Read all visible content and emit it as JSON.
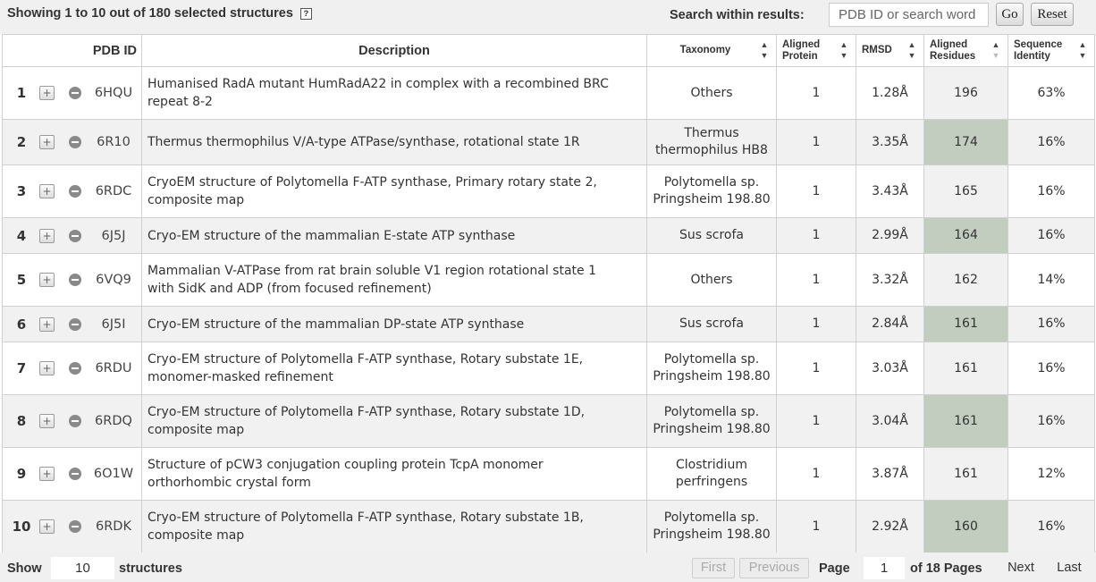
{
  "header": {
    "showing_text": "Showing 1 to 10 out of 180 selected structures",
    "help_icon": "?",
    "search_label": "Search within results:",
    "search_placeholder": "PDB ID or search word",
    "go_label": "Go",
    "reset_label": "Reset"
  },
  "columns": {
    "pdb_id": "PDB ID",
    "description": "Description",
    "taxonomy": "Taxonomy",
    "aligned_protein": [
      "Aligned",
      "Protein"
    ],
    "rmsd": "RMSD",
    "aligned_residues": [
      "Aligned",
      "Residues"
    ],
    "sequence_identity": [
      "Sequence",
      "Identity"
    ],
    "sort_up": "▲",
    "sort_down": "▼",
    "active_sort": "aligned_residues-desc"
  },
  "icons": {
    "expand": "plus-icon",
    "cart": "circle-minus-icon",
    "expand_glyph": "+"
  },
  "colors": {
    "highlight_cell": "#c2cdbf",
    "row_alt": "#f1f1f1",
    "bar_bg": "#f0f0f0"
  },
  "rows": [
    {
      "num": "1",
      "pdb": "6HQU",
      "desc": [
        "Humanised RadA mutant HumRadA22 in complex with a recombined BRC",
        "repeat 8-2"
      ],
      "tax": [
        "Others"
      ],
      "aligned": "1",
      "rmsd": "1.28Å",
      "residues": "196",
      "identity": "63%"
    },
    {
      "num": "2",
      "pdb": "6R10",
      "desc": [
        "Thermus thermophilus V/A-type ATPase/synthase, rotational state 1R"
      ],
      "tax": [
        "Thermus",
        "thermophilus HB8"
      ],
      "aligned": "1",
      "rmsd": "3.35Å",
      "residues": "174",
      "identity": "16%"
    },
    {
      "num": "3",
      "pdb": "6RDC",
      "desc": [
        "CryoEM structure of Polytomella F-ATP synthase, Primary rotary state 2,",
        "composite map"
      ],
      "tax": [
        "Polytomella sp.",
        "Pringsheim 198.80"
      ],
      "aligned": "1",
      "rmsd": "3.43Å",
      "residues": "165",
      "identity": "16%"
    },
    {
      "num": "4",
      "pdb": "6J5J",
      "desc": [
        "Cryo-EM structure of the mammalian E-state ATP synthase"
      ],
      "tax": [
        "Sus scrofa"
      ],
      "aligned": "1",
      "rmsd": "2.99Å",
      "residues": "164",
      "identity": "16%"
    },
    {
      "num": "5",
      "pdb": "6VQ9",
      "desc": [
        "Mammalian V-ATPase from rat brain soluble V1 region rotational state 1",
        "with SidK and ADP (from focused refinement)"
      ],
      "tax": [
        "Others"
      ],
      "aligned": "1",
      "rmsd": "3.32Å",
      "residues": "162",
      "identity": "14%"
    },
    {
      "num": "6",
      "pdb": "6J5I",
      "desc": [
        "Cryo-EM structure of the mammalian DP-state ATP synthase"
      ],
      "tax": [
        "Sus scrofa"
      ],
      "aligned": "1",
      "rmsd": "2.84Å",
      "residues": "161",
      "identity": "16%"
    },
    {
      "num": "7",
      "pdb": "6RDU",
      "desc": [
        "Cryo-EM structure of Polytomella F-ATP synthase, Rotary substate 1E,",
        "monomer-masked refinement"
      ],
      "tax": [
        "Polytomella sp.",
        "Pringsheim 198.80"
      ],
      "aligned": "1",
      "rmsd": "3.03Å",
      "residues": "161",
      "identity": "16%"
    },
    {
      "num": "8",
      "pdb": "6RDQ",
      "desc": [
        "Cryo-EM structure of Polytomella F-ATP synthase, Rotary substate 1D,",
        "composite map"
      ],
      "tax": [
        "Polytomella sp.",
        "Pringsheim 198.80"
      ],
      "aligned": "1",
      "rmsd": "3.04Å",
      "residues": "161",
      "identity": "16%"
    },
    {
      "num": "9",
      "pdb": "6O1W",
      "desc": [
        "Structure of pCW3 conjugation coupling protein TcpA monomer",
        "orthorhombic crystal form"
      ],
      "tax": [
        "Clostridium",
        "perfringens"
      ],
      "aligned": "1",
      "rmsd": "3.87Å",
      "residues": "161",
      "identity": "12%"
    },
    {
      "num": "10",
      "pdb": "6RDK",
      "desc": [
        "Cryo-EM structure of Polytomella F-ATP synthase, Rotary substate 1B,",
        "composite map"
      ],
      "tax": [
        "Polytomella sp.",
        "Pringsheim 198.80"
      ],
      "aligned": "1",
      "rmsd": "2.92Å",
      "residues": "160",
      "identity": "16%"
    }
  ],
  "footer": {
    "show_label": "Show",
    "show_value": "10",
    "structures_label": "structures",
    "first_label": "First",
    "previous_label": "Previous",
    "page_label": "Page",
    "page_value": "1",
    "of_pages_label": "of 18 Pages",
    "next_label": "Next",
    "last_label": "Last"
  }
}
